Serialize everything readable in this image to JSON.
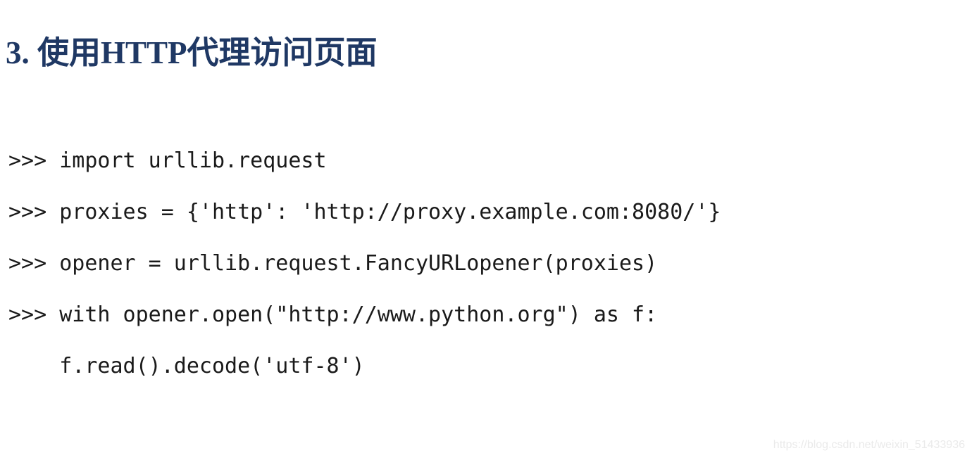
{
  "slide": {
    "title": "3. 使用HTTP代理访问页面",
    "title_color": "#1f3864",
    "background_color": "#ffffff",
    "code_color": "#1a1a1a"
  },
  "code": {
    "language": "python-repl",
    "lines": [
      ">>> import urllib.request",
      ">>> proxies = {'http': 'http://proxy.example.com:8080/'}",
      ">>> opener = urllib.request.FancyURLopener(proxies)",
      ">>> with opener.open(\"http://www.python.org\") as f:",
      "    f.read().decode('utf-8')"
    ]
  },
  "watermark": {
    "text": "https://blog.csdn.net/weixin_51433936",
    "color": "#eaeaea"
  }
}
